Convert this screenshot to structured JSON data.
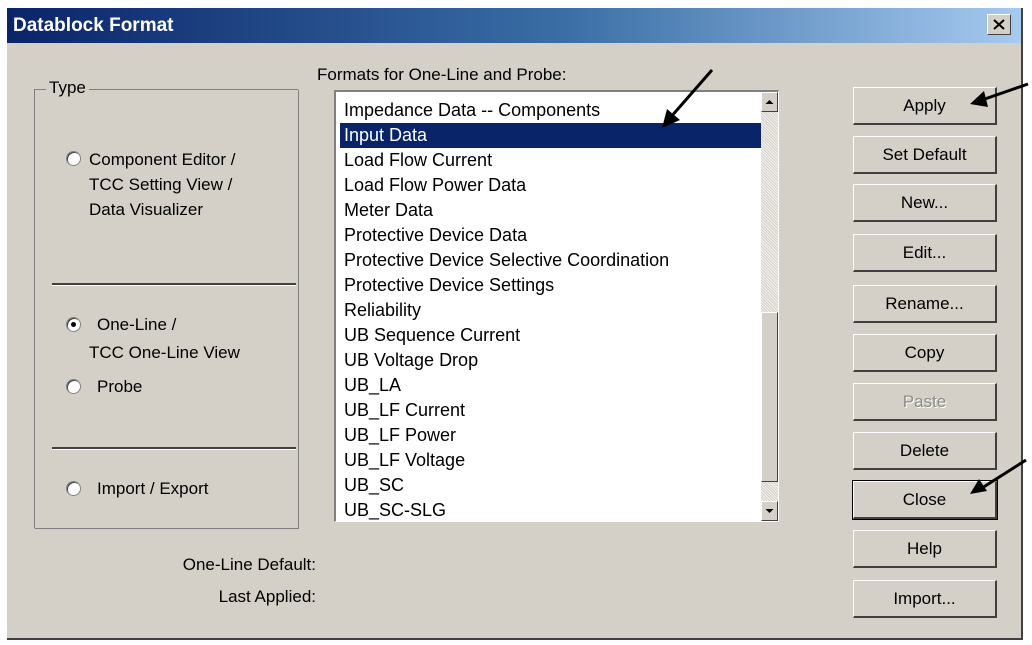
{
  "window": {
    "title": "Datablock Format"
  },
  "type_group": {
    "label": "Type",
    "options": [
      {
        "line1": "Component Editor /",
        "line2": "TCC Setting View /",
        "line3": "Data Visualizer",
        "checked": false
      },
      {
        "line1": "One-Line /",
        "line2": "TCC One-Line View",
        "checked": true
      },
      {
        "line1": "Probe",
        "checked": false
      },
      {
        "line1": "Import / Export",
        "checked": false
      }
    ]
  },
  "formats": {
    "label": "Formats for One-Line and Probe:",
    "items": [
      "Impedance Data -- Components",
      "Input Data",
      "Load Flow Current",
      "Load Flow Power Data",
      "Meter Data",
      "Protective Device Data",
      "Protective Device Selective Coordination",
      "Protective Device Settings",
      "Reliability",
      "UB Sequence Current",
      "UB Voltage Drop",
      "UB_LA",
      "UB_LF Current",
      "UB_LF Power",
      "UB_LF Voltage",
      "UB_SC",
      "UB_SC-SLG"
    ],
    "selected": "Input Data"
  },
  "buttons": {
    "apply": "Apply",
    "set_default": "Set Default",
    "new": "New...",
    "edit": "Edit...",
    "rename": "Rename...",
    "copy": "Copy",
    "paste": "Paste",
    "delete": "Delete",
    "close": "Close",
    "help": "Help",
    "import": "Import..."
  },
  "info": {
    "one_line_default": "One-Line Default:",
    "last_applied": "Last Applied:"
  }
}
